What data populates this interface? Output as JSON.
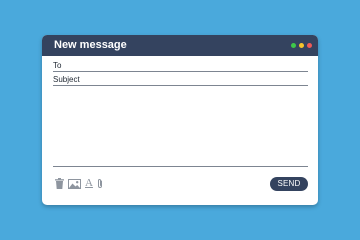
{
  "window": {
    "title": "New message",
    "controls": [
      {
        "name": "minimize-dot",
        "color": "#3ec84a"
      },
      {
        "name": "maximize-dot",
        "color": "#f5c42c"
      },
      {
        "name": "close-dot",
        "color": "#ef5a57"
      }
    ]
  },
  "compose": {
    "to_label": "To",
    "subject_label": "Subject"
  },
  "toolbar": {
    "icons": [
      "trash-icon",
      "image-icon",
      "font-format-icon",
      "attachment-icon"
    ],
    "font_glyph": "A"
  },
  "actions": {
    "send_label": "SEND"
  },
  "colors": {
    "background": "#4aa9dc",
    "titlebar": "#34435f",
    "send_button": "#34435f",
    "icon": "#8e959f"
  }
}
